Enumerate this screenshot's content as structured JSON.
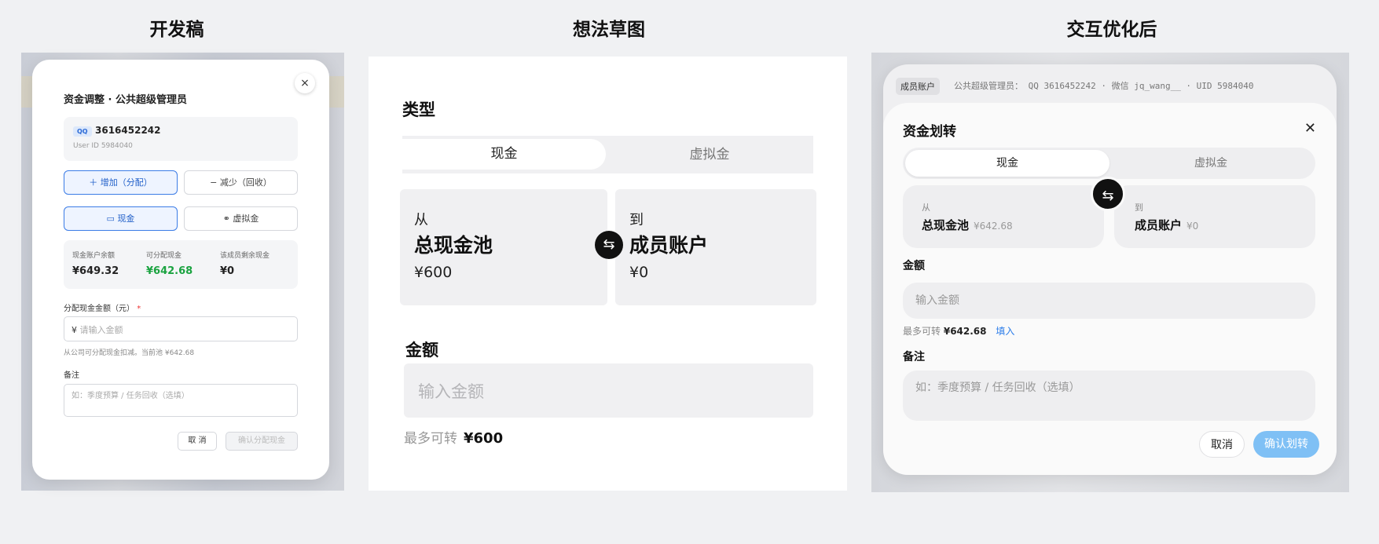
{
  "headings": {
    "dev": "开发稿",
    "sketch": "想法草图",
    "optimized": "交互优化后"
  },
  "dev": {
    "title": "资金调整 · 公共超级管理员",
    "close_glyph": "×",
    "qq_badge": "QQ",
    "qq_number": "3616452242",
    "user_id": "User ID 5984040",
    "btn_increase": "＋ 增加（分配）",
    "btn_decrease": "− 减少（回收）",
    "btn_cash": "现金",
    "btn_virtual": "虚拟金",
    "stats": [
      {
        "label": "现金账户余额",
        "value": "¥649.32",
        "color": "#222222"
      },
      {
        "label": "可分配现金",
        "value": "¥642.68",
        "color": "#1aa340"
      },
      {
        "label": "该成员剩余现金",
        "value": "¥0",
        "color": "#222222"
      }
    ],
    "amount_label": "分配现金金额（元）",
    "required_mark": "*",
    "currency_symbol": "¥",
    "amount_placeholder": "请输入金额",
    "amount_hint": "从公司可分配现金扣减。当前池 ¥642.68",
    "note_label": "备注",
    "note_placeholder": "如：季度预算 / 任务回收（选填）",
    "cancel": "取 消",
    "confirm": "确认分配现金"
  },
  "sketch": {
    "type_label": "类型",
    "tab_cash": "现金",
    "tab_virtual": "虚拟金",
    "from_label": "从",
    "from_name": "总现金池",
    "from_amount": "¥600",
    "to_label": "到",
    "to_name": "成员账户",
    "to_amount": "¥0",
    "amount_label": "金额",
    "amount_placeholder": "输入金额",
    "max_label": "最多可转",
    "max_value": "¥600"
  },
  "optimized": {
    "member_tag": "成员账户",
    "member_role": "公共超级管理员：",
    "member_ids": "QQ 3616452242 · 微信 jq_wang__ · UID 5984040",
    "title": "资金划转",
    "close_glyph": "✕",
    "tab_cash": "现金",
    "tab_virtual": "虚拟金",
    "from_label": "从",
    "from_name": "总现金池",
    "from_amount": "¥642.68",
    "to_label": "到",
    "to_name": "成员账户",
    "to_amount": "¥0",
    "amount_label": "金额",
    "amount_placeholder": "输入金额",
    "max_label": "最多可转",
    "max_value": "¥642.68",
    "fill_link": "填入",
    "note_label": "备注",
    "note_placeholder": "如：季度预算 / 任务回收（选填）",
    "cancel": "取消",
    "confirm": "确认划转"
  }
}
